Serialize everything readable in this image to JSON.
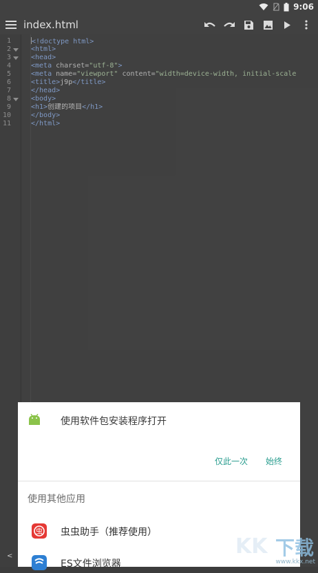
{
  "status_bar": {
    "time": "9:06"
  },
  "app_bar": {
    "title": "index.html",
    "icons": [
      "menu-icon",
      "undo-icon",
      "redo-icon",
      "save-icon",
      "image-icon",
      "run-icon",
      "more-vert-icon"
    ]
  },
  "editor": {
    "line_numbers": [
      "1",
      "2",
      "3",
      "4",
      "5",
      "6",
      "7",
      "8",
      "9",
      "10",
      "11"
    ],
    "folded_lines": [
      2,
      3,
      8
    ],
    "lines": [
      [
        {
          "c": "tag",
          "t": "<!doctype html>"
        }
      ],
      [
        {
          "c": "tag",
          "t": "<html>"
        }
      ],
      [
        {
          "c": "tag",
          "t": "<head>"
        }
      ],
      [
        {
          "c": "txt",
          "t": "    "
        },
        {
          "c": "tag",
          "t": "<meta "
        },
        {
          "c": "attr",
          "t": "charset="
        },
        {
          "c": "str",
          "t": "\"utf-8\""
        },
        {
          "c": "tag",
          "t": ">"
        }
      ],
      [
        {
          "c": "txt",
          "t": "    "
        },
        {
          "c": "tag",
          "t": "<meta "
        },
        {
          "c": "attr",
          "t": "name="
        },
        {
          "c": "str",
          "t": "\"viewport\""
        },
        {
          "c": "attr",
          "t": " content="
        },
        {
          "c": "str",
          "t": "\"width=device-width, initial-scale"
        }
      ],
      [
        {
          "c": "txt",
          "t": "    "
        },
        {
          "c": "tag",
          "t": "<title>"
        },
        {
          "c": "txt",
          "t": "j9p"
        },
        {
          "c": "tag",
          "t": "</title>"
        }
      ],
      [
        {
          "c": "tag",
          "t": "</head>"
        }
      ],
      [
        {
          "c": "tag",
          "t": "<body>"
        }
      ],
      [
        {
          "c": "txt",
          "t": "     "
        },
        {
          "c": "tag",
          "t": "<h1>"
        },
        {
          "c": "txt",
          "t": "创建的项目"
        },
        {
          "c": "tag",
          "t": "</h1>"
        }
      ],
      [
        {
          "c": "tag",
          "t": "</body>"
        }
      ],
      [
        {
          "c": "tag",
          "t": "</html>"
        }
      ]
    ]
  },
  "sheet": {
    "package_installer_label": "使用软件包安装程序打开",
    "just_once_label": "仅此一次",
    "always_label": "始终",
    "other_apps_label": "使用其他应用",
    "apps": [
      {
        "name": "虫虫助手（推荐使用）",
        "color": "#e53935",
        "glyph": "虫"
      },
      {
        "name": "ES文件浏览器",
        "color": "#2d7fd3",
        "glyph": "≋"
      }
    ]
  },
  "watermark": {
    "text": "www.kkx.net"
  },
  "bottom_left": "<"
}
